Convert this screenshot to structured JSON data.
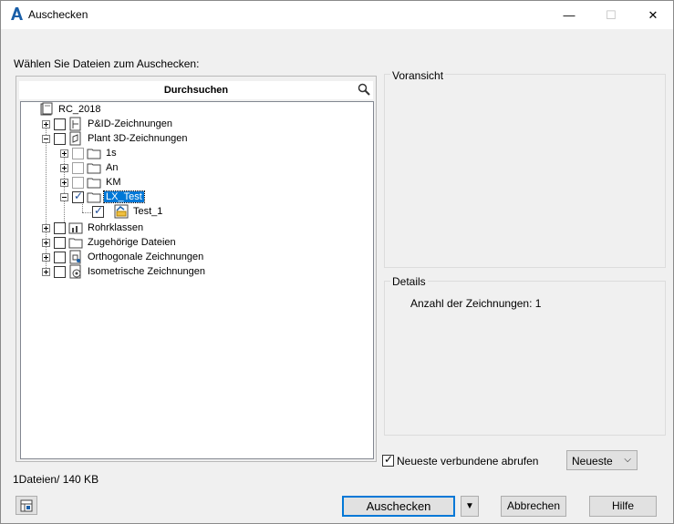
{
  "window": {
    "title": "Auschecken",
    "icon": "autocad-a-icon"
  },
  "controls": {
    "minimize": "—",
    "maximize": "☐",
    "close": "✕"
  },
  "instruction": "Wählen Sie Dateien zum Auschecken:",
  "search": {
    "label": "Durchsuchen",
    "icon": "magnifier-icon"
  },
  "tree": {
    "root": "RC_2018",
    "items": [
      {
        "label": "P&ID-Zeichnungen"
      },
      {
        "label": "Plant 3D-Zeichnungen"
      },
      {
        "label": "1s"
      },
      {
        "label": "An"
      },
      {
        "label": "KM"
      },
      {
        "label": "LX_Test"
      },
      {
        "label": "Test_1"
      },
      {
        "label": "Rohrklassen"
      },
      {
        "label": "Zugehörige Dateien"
      },
      {
        "label": "Orthogonale Zeichnungen"
      },
      {
        "label": "Isometrische Zeichnungen"
      }
    ]
  },
  "preview": {
    "title": "Voransicht"
  },
  "details": {
    "title": "Details",
    "text": "Anzahl der Zeichnungen: 1"
  },
  "options": {
    "latest_label": "Neueste verbundene abrufen",
    "latest_checked": true,
    "dropdown_value": "Neueste",
    "dropdown_arrow": "⌵"
  },
  "status": "1Dateien/ 140 KB",
  "buttons": {
    "checkout": "Auschecken",
    "dropdown_arrow": "▼",
    "cancel": "Abbrechen",
    "help": "Hilfe"
  },
  "colors": {
    "selection": "#0078d7",
    "accent": "#0078d7"
  }
}
